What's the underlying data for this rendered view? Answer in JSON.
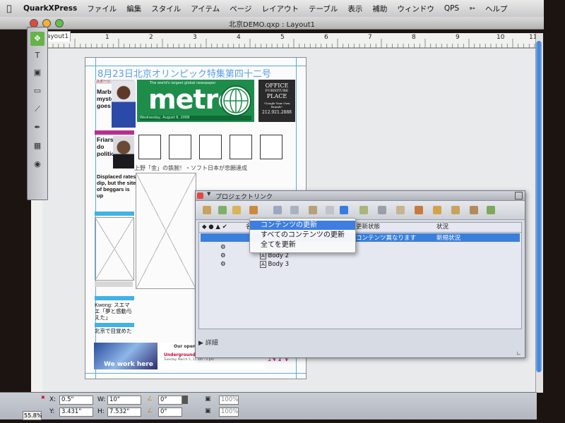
{
  "menubar": {
    "app": "QuarkXPress",
    "items": [
      "ファイル",
      "編集",
      "スタイル",
      "アイテム",
      "ページ",
      "レイアウト",
      "テーブル",
      "表示",
      "補助",
      "ウィンドウ",
      "QPS",
      "ヘルプ"
    ]
  },
  "window": {
    "title": "北京DEMO.qxp : Layout1",
    "layout_tab": "Layout1"
  },
  "ruler": {
    "labels": [
      "1",
      "2",
      "3",
      "4",
      "5",
      "6",
      "7",
      "8",
      "9",
      "10",
      "11"
    ]
  },
  "document": {
    "headline": "8月23日北京オリンピック特集第四十二号",
    "sports_tag": "スポーツ",
    "story1": [
      "Marbury",
      "mystery",
      "goes"
    ],
    "story2": [
      "Friars",
      "do",
      "politic"
    ],
    "story3": [
      "Displaced rates",
      "dip, but the site",
      "of beggars is up"
    ],
    "story4": [
      "Kwong: スエマ",
      "エ「夢と感動与",
      "えた」"
    ],
    "story5": "北京で目覚めた",
    "caption_bar": "上野「金」の鉄腕！・ソフト日本が悲願達成",
    "metro": {
      "tagline": "The world's largest global newspaper",
      "logo": "metro",
      "date": "Wednesday, August 6, 2008"
    },
    "office": {
      "line1": "OFFICE",
      "line2": "FURNITURE",
      "line3": "PLACE",
      "line4": "\"Google Your Own Brands\"",
      "phone": "212.921.2888"
    },
    "banner": {
      "slogan": "We work here",
      "open": "Our open",
      "sub": "Underground Art Contest",
      "date": "Tuesday March 5, 11 am - 2 pm",
      "logo": "NYV"
    }
  },
  "palette": {
    "title": "プロジェクトリンク",
    "columns": [
      "名",
      "更新状態",
      "状況"
    ],
    "rows": [
      {
        "name": "",
        "update": "コンテンツ異なります",
        "status": "新規状況"
      },
      {
        "name": "Body 2"
      },
      {
        "name": "Body 3"
      }
    ],
    "detail_label": "詳細"
  },
  "context_menu": {
    "items": [
      "コンテンツの更新",
      "すべてのコンテンツの更新",
      "全てを更新"
    ],
    "highlighted_index": 0
  },
  "measurements": {
    "x_label": "X:",
    "x": "0.5\"",
    "y_label": "Y:",
    "y": "3.431\"",
    "w_label": "W:",
    "w": "10\"",
    "h_label": "H:",
    "h": "7.532\"",
    "angle1": "0°",
    "angle2": "0°",
    "scale1": "100%",
    "scale2": "100%",
    "zoom": "55.8%"
  },
  "colors": {
    "accent_blue": "#3b7fdc",
    "metro_green": "#1e8d4a",
    "guide_blue": "#5aa8e6"
  }
}
